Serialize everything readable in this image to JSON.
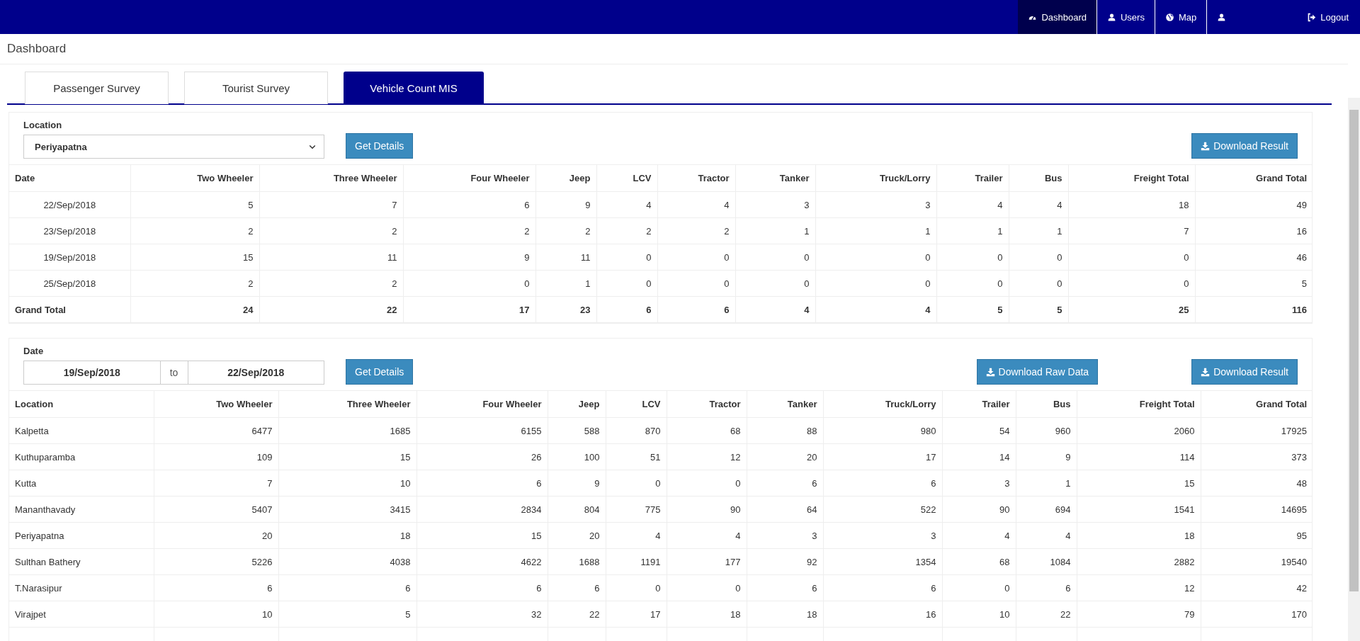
{
  "navbar": {
    "items": [
      {
        "kind": "link",
        "label": "Dashboard",
        "selected": true
      },
      {
        "kind": "link",
        "label": "Users",
        "selected": false
      },
      {
        "kind": "link",
        "label": "Map",
        "selected": false
      },
      {
        "kind": "profile",
        "selected": false
      },
      {
        "kind": "logout",
        "label": "Logout",
        "selected": false
      }
    ]
  },
  "page_title": "Dashboard",
  "tabs": [
    {
      "label": "Passenger Survey",
      "selected": false
    },
    {
      "label": "Tourist Survey",
      "selected": false
    },
    {
      "label": "Vehicle Count MIS",
      "selected": true
    }
  ],
  "location_panel": {
    "filter": {
      "label": "Location",
      "value": "Periyapatna"
    },
    "get_details": "Get Details",
    "buttons": [
      "Download Result"
    ],
    "table": {
      "columns": [
        "Date",
        "Two Wheeler",
        "Three Wheeler",
        "Four Wheeler",
        "Jeep",
        "LCV",
        "Tractor",
        "Tanker",
        "Truck/Lorry",
        "Trailer",
        "Bus",
        "Freight Total",
        "Grand Total"
      ],
      "rows": [
        {
          "kind": "data",
          "cells": [
            "22/Sep/2018",
            "5",
            "7",
            "6",
            "9",
            "4",
            "4",
            "3",
            "3",
            "4",
            "4",
            "18",
            "49"
          ]
        },
        {
          "kind": "data",
          "cells": [
            "23/Sep/2018",
            "2",
            "2",
            "2",
            "2",
            "2",
            "2",
            "1",
            "1",
            "1",
            "1",
            "7",
            "16"
          ]
        },
        {
          "kind": "data",
          "cells": [
            "19/Sep/2018",
            "15",
            "11",
            "9",
            "11",
            "0",
            "0",
            "0",
            "0",
            "0",
            "0",
            "0",
            "46"
          ]
        },
        {
          "kind": "data",
          "cells": [
            "25/Sep/2018",
            "2",
            "2",
            "0",
            "1",
            "0",
            "0",
            "0",
            "0",
            "0",
            "0",
            "0",
            "5"
          ]
        },
        {
          "kind": "total",
          "cells": [
            "Grand Total",
            "24",
            "22",
            "17",
            "23",
            "6",
            "6",
            "4",
            "4",
            "5",
            "5",
            "25",
            "116"
          ]
        }
      ]
    }
  },
  "date_panel": {
    "filter": {
      "label": "Date",
      "from": "19/Sep/2018",
      "separator": "to",
      "to": "22/Sep/2018"
    },
    "get_details": "Get Details",
    "buttons": [
      "Download Raw Data",
      "Download Result"
    ],
    "table": {
      "columns": [
        "Location",
        "Two Wheeler",
        "Three Wheeler",
        "Four Wheeler",
        "Jeep",
        "LCV",
        "Tractor",
        "Tanker",
        "Truck/Lorry",
        "Trailer",
        "Bus",
        "Freight Total",
        "Grand Total"
      ],
      "rows": [
        {
          "cells": [
            "Kalpetta",
            "6477",
            "1685",
            "6155",
            "588",
            "870",
            "68",
            "88",
            "980",
            "54",
            "960",
            "2060",
            "17925"
          ]
        },
        {
          "cells": [
            "Kuthuparamba",
            "109",
            "15",
            "26",
            "100",
            "51",
            "12",
            "20",
            "17",
            "14",
            "9",
            "114",
            "373"
          ]
        },
        {
          "cells": [
            "Kutta",
            "7",
            "10",
            "6",
            "9",
            "0",
            "0",
            "6",
            "6",
            "3",
            "1",
            "15",
            "48"
          ]
        },
        {
          "cells": [
            "Mananthavady",
            "5407",
            "3415",
            "2834",
            "804",
            "775",
            "90",
            "64",
            "522",
            "90",
            "694",
            "1541",
            "14695"
          ]
        },
        {
          "cells": [
            "Periyapatna",
            "20",
            "18",
            "15",
            "20",
            "4",
            "4",
            "3",
            "3",
            "4",
            "4",
            "18",
            "95"
          ]
        },
        {
          "cells": [
            "Sulthan Bathery",
            "5226",
            "4038",
            "4622",
            "1688",
            "1191",
            "177",
            "92",
            "1354",
            "68",
            "1084",
            "2882",
            "19540"
          ]
        },
        {
          "cells": [
            "T.Narasipur",
            "6",
            "6",
            "6",
            "6",
            "0",
            "0",
            "6",
            "6",
            "0",
            "6",
            "12",
            "42"
          ]
        },
        {
          "cells": [
            "Virajpet",
            "10",
            "5",
            "32",
            "22",
            "17",
            "18",
            "18",
            "16",
            "10",
            "22",
            "79",
            "170"
          ]
        }
      ]
    }
  }
}
